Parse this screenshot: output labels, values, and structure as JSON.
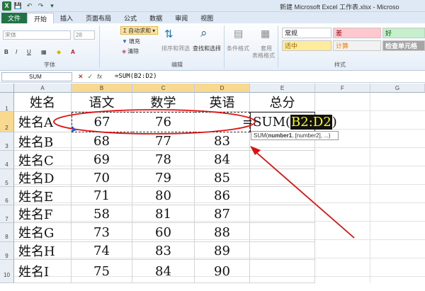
{
  "title": "新建 Microsoft Excel 工作表.xlsx - Microso",
  "qat": {
    "app": "X",
    "save": "💾",
    "undo": "↶",
    "redo": "↷",
    "customize": "▾"
  },
  "tabs": [
    {
      "label": "文件"
    },
    {
      "label": "开始"
    },
    {
      "label": "插入"
    },
    {
      "label": "页面布局"
    },
    {
      "label": "公式"
    },
    {
      "label": "数据"
    },
    {
      "label": "审阅"
    },
    {
      "label": "视图"
    }
  ],
  "ribbon": {
    "font_name": "宋体",
    "font_size": "28",
    "bold": "B",
    "italic": "I",
    "underline": "U",
    "font_group": "字体",
    "autosum": "Σ 自动求和",
    "fill": "填充",
    "clear": "清除",
    "sort_filter": "排序和筛选",
    "find_select": "查找和选择",
    "edit_group": "编辑",
    "cond_format": "条件格式",
    "table_format_1": "套用",
    "table_format_2": "表格格式",
    "styles_group": "样式",
    "styles": [
      "常规",
      "差",
      "好",
      "适中",
      "计算",
      "检查单元格"
    ]
  },
  "formula_bar": {
    "name_box": "SUM",
    "cancel": "✕",
    "enter": "✓",
    "fx": "fx",
    "content": "=SUM(B2:D2)"
  },
  "columns": [
    "A",
    "B",
    "C",
    "D",
    "E",
    "F",
    "G"
  ],
  "rows": [
    "1",
    "2",
    "3",
    "4",
    "5",
    "6",
    "7",
    "8",
    "9",
    "10"
  ],
  "sheet": {
    "header": [
      "姓名",
      "语文",
      "数学",
      "英语",
      "总分"
    ],
    "data": [
      [
        "姓名A",
        "67",
        "76",
        ""
      ],
      [
        "姓名B",
        "68",
        "77",
        "83"
      ],
      [
        "姓名C",
        "69",
        "78",
        "84"
      ],
      [
        "姓名D",
        "70",
        "79",
        "85"
      ],
      [
        "姓名E",
        "71",
        "80",
        "86"
      ],
      [
        "姓名F",
        "58",
        "81",
        "87"
      ],
      [
        "姓名G",
        "73",
        "60",
        "88"
      ],
      [
        "姓名H",
        "74",
        "83",
        "89"
      ],
      [
        "姓名I",
        "75",
        "84",
        "90"
      ]
    ],
    "edit_cell": {
      "prefix": "=SUM(",
      "ref": "B2:D2",
      "suffix": ")"
    }
  },
  "tooltip": {
    "fn": "SUM(",
    "arg1": "number1",
    "rest": ", [number2], ...)"
  },
  "colors": {
    "selection": "#f9d88f",
    "annotation": "#e01010",
    "file_tab": "#217346"
  }
}
